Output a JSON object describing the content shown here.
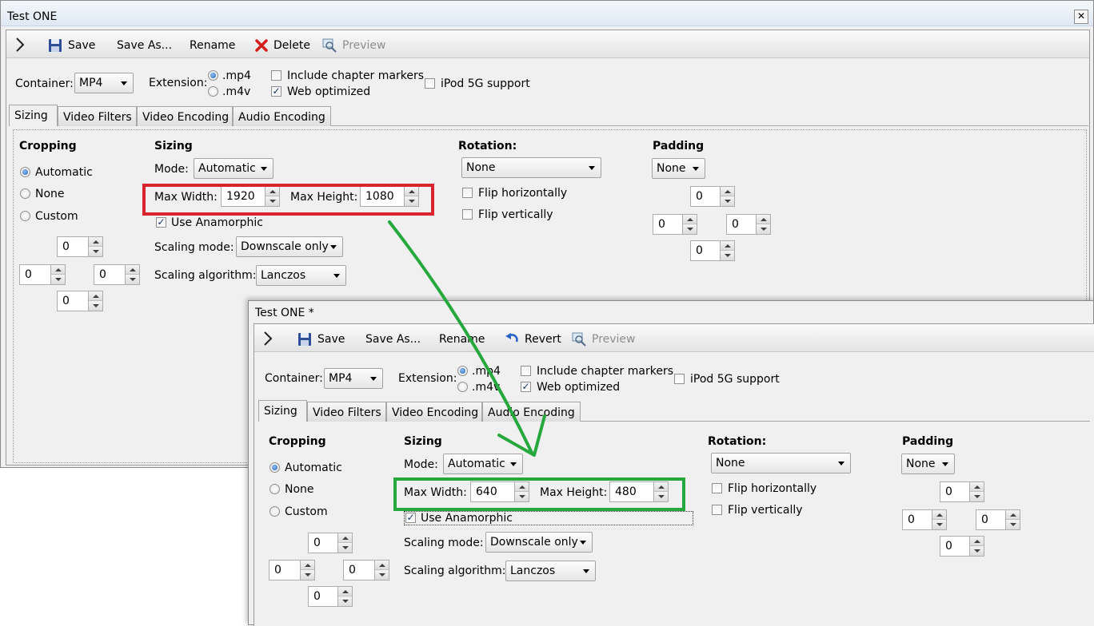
{
  "colors": {
    "highlight_red": "#d9232e",
    "highlight_green": "#26a83d",
    "arrow": "#26a83d"
  },
  "icons": {
    "toolbar_toggle": "chevron-right-icon",
    "save": "floppy-disk-icon",
    "delete": "red-x-icon",
    "preview": "magnifier-icon",
    "revert": "undo-arrow-icon",
    "close": "close-icon"
  },
  "window1": {
    "title": "Test ONE",
    "close_glyph": "✕",
    "toolbar": {
      "save": "Save",
      "save_as": "Save As...",
      "rename": "Rename",
      "delete": "Delete",
      "preview": "Preview"
    },
    "container_label": "Container:",
    "container_value": "MP4",
    "extension_label": "Extension:",
    "ext_mp4": ".mp4",
    "ext_m4v": ".m4v",
    "include_chapters": "Include chapter markers",
    "web_optimized": "Web optimized",
    "ipod": "iPod 5G support",
    "tabs": [
      "Sizing",
      "Video Filters",
      "Video Encoding",
      "Audio Encoding"
    ],
    "cropping": {
      "title": "Cropping",
      "automatic": "Automatic",
      "none": "None",
      "custom": "Custom",
      "top": "0",
      "left": "0",
      "right": "0",
      "bottom": "0"
    },
    "sizing": {
      "title": "Sizing",
      "mode_label": "Mode:",
      "mode_value": "Automatic",
      "max_width_label": "Max Width:",
      "max_width": "1920",
      "max_height_label": "Max Height:",
      "max_height": "1080",
      "anamorphic": "Use Anamorphic",
      "scaling_mode_label": "Scaling mode:",
      "scaling_mode_value": "Downscale only",
      "scaling_algo_label": "Scaling algorithm:",
      "scaling_algo_value": "Lanczos"
    },
    "rotation": {
      "title": "Rotation:",
      "value": "None",
      "flip_h": "Flip horizontally",
      "flip_v": "Flip vertically"
    },
    "padding": {
      "title": "Padding",
      "value": "None",
      "top": "0",
      "left": "0",
      "right": "0",
      "bottom": "0"
    }
  },
  "window2": {
    "title": "Test ONE *",
    "toolbar": {
      "save": "Save",
      "save_as": "Save As...",
      "rename": "Rename",
      "revert": "Revert",
      "preview": "Preview"
    },
    "container_label": "Container:",
    "container_value": "MP4",
    "extension_label": "Extension:",
    "ext_mp4": ".mp4",
    "ext_m4v": ".m4v",
    "include_chapters": "Include chapter markers",
    "web_optimized": "Web optimized",
    "ipod": "iPod 5G support",
    "tabs": [
      "Sizing",
      "Video Filters",
      "Video Encoding",
      "Audio Encoding"
    ],
    "cropping": {
      "title": "Cropping",
      "automatic": "Automatic",
      "none": "None",
      "custom": "Custom",
      "top": "0",
      "left": "0",
      "right": "0",
      "bottom": "0"
    },
    "sizing": {
      "title": "Sizing",
      "mode_label": "Mode:",
      "mode_value": "Automatic",
      "max_width_label": "Max Width:",
      "max_width": "640",
      "max_height_label": "Max Height:",
      "max_height": "480",
      "anamorphic": "Use Anamorphic",
      "scaling_mode_label": "Scaling mode:",
      "scaling_mode_value": "Downscale only",
      "scaling_algo_label": "Scaling algorithm:",
      "scaling_algo_value": "Lanczos"
    },
    "rotation": {
      "title": "Rotation:",
      "value": "None",
      "flip_h": "Flip horizontally",
      "flip_v": "Flip vertically"
    },
    "padding": {
      "title": "Padding",
      "value": "None",
      "top": "0",
      "left": "0",
      "right": "0",
      "bottom": "0"
    }
  }
}
